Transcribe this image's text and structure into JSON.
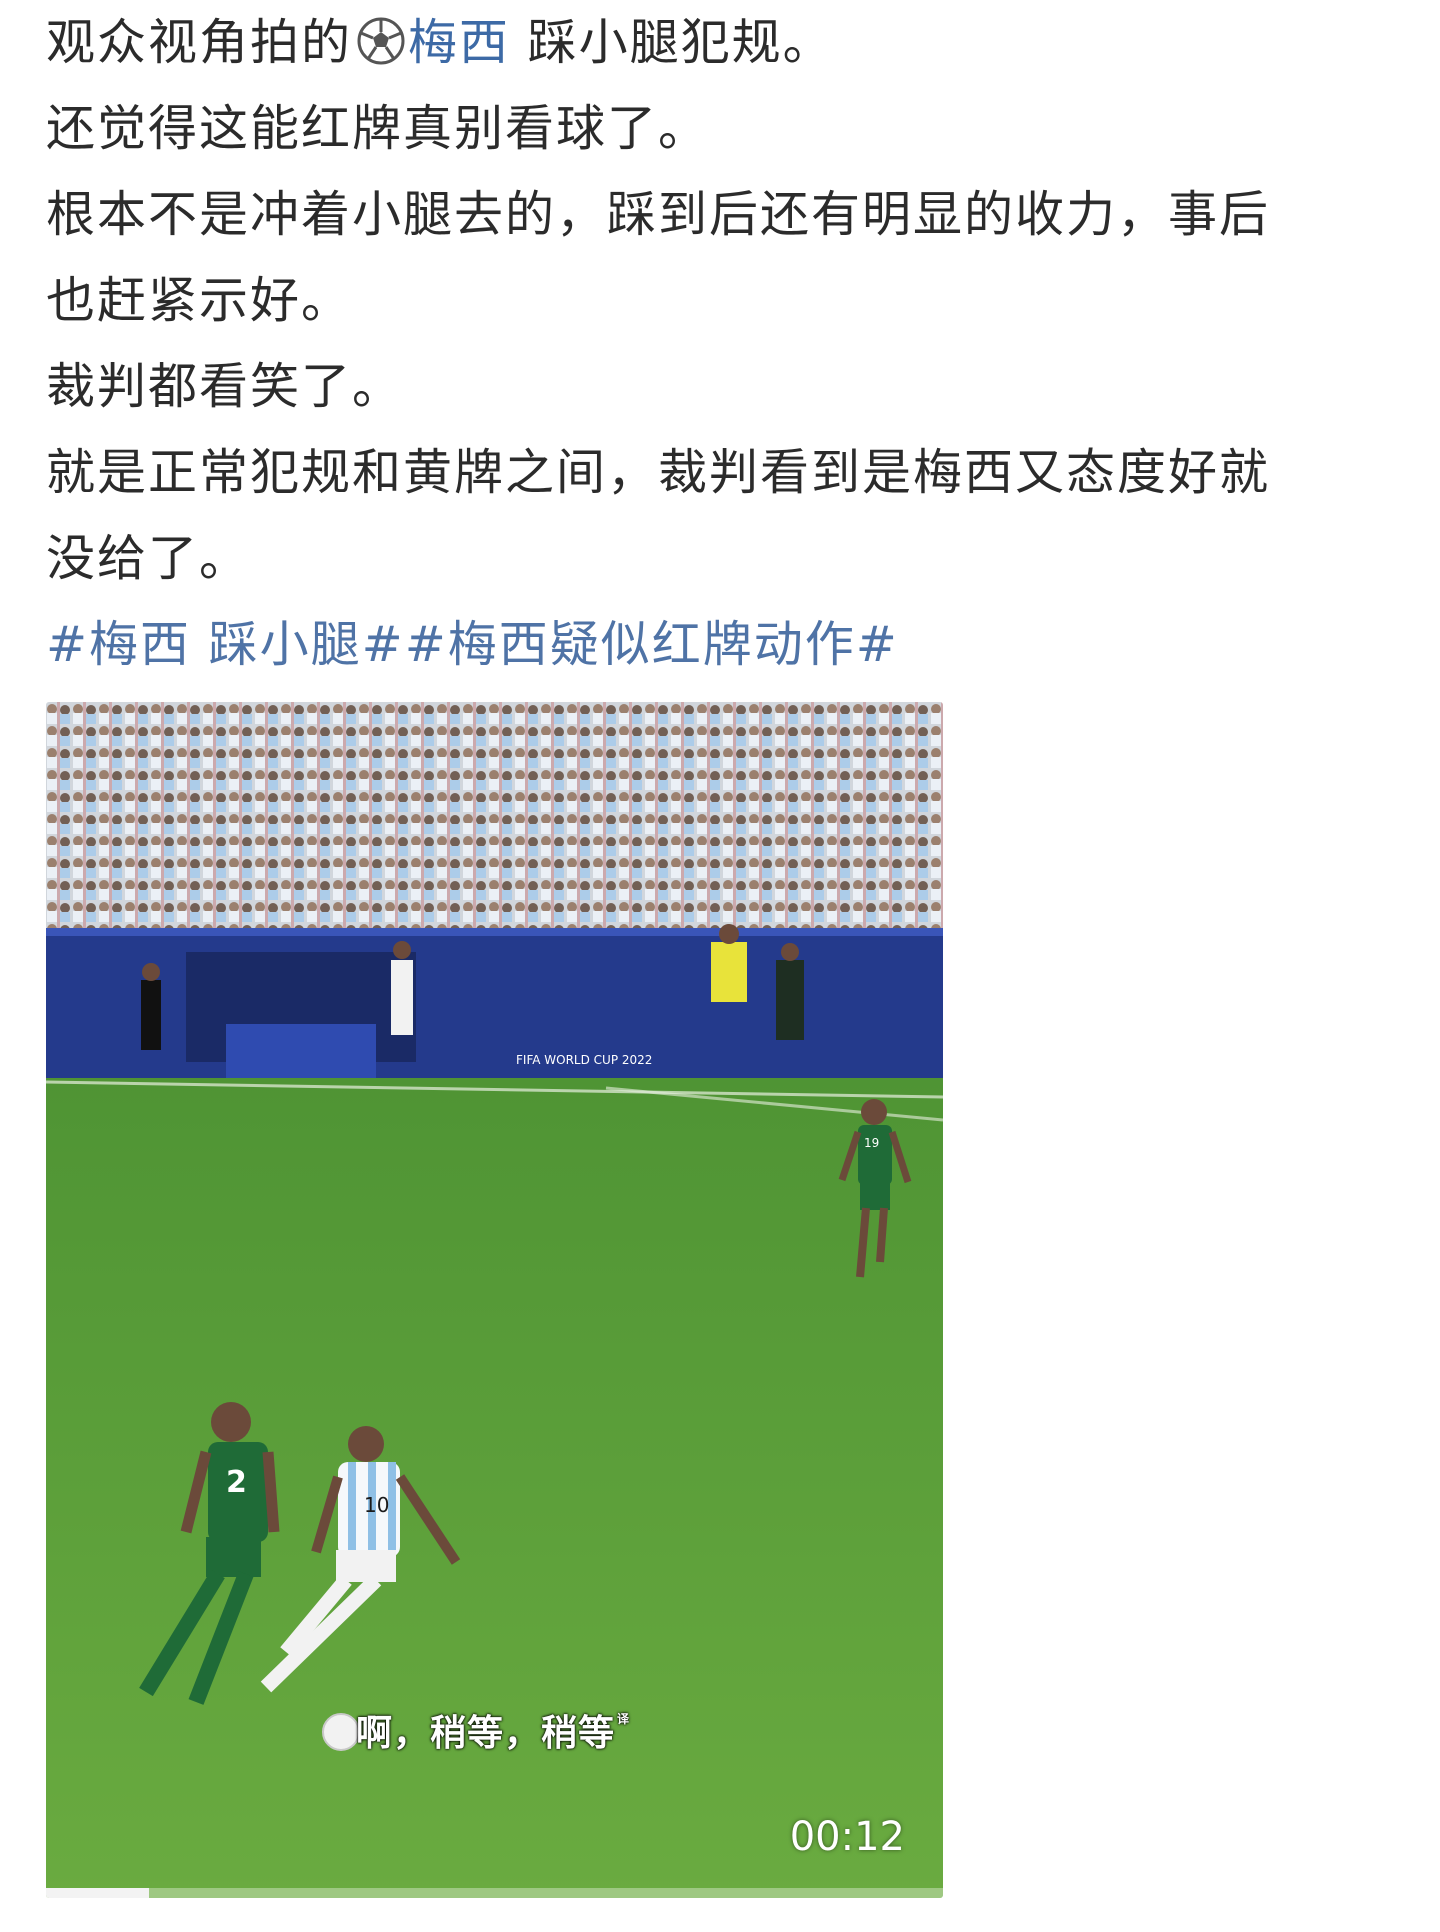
{
  "post": {
    "line1_before": "观众视角拍的",
    "mention": "梅西",
    "line1_after": " 踩小腿犯规。",
    "line2": "还觉得这能红牌真别看球了。",
    "line3a": "根本不是冲着小腿去的，踩到后还有明显的收力，事后",
    "line3b": "也赶紧示好。",
    "line4": "裁判都看笑了。",
    "line5a": "就是正常犯规和黄牌之间，裁判看到是梅西又态度好就",
    "line5b": "没给了。",
    "topic1": "#梅西 踩小腿#",
    "topic2": "#梅西疑似红牌动作#"
  },
  "video": {
    "subtitle": "啊，稍等，稍等",
    "subtitle_mark": "译",
    "timestamp": "00:12",
    "progress": 0.115,
    "board_text": "FIFA WORLD CUP 2022",
    "player_front_number": "2",
    "player_back_number": "10",
    "player_far_number": "19"
  },
  "colors": {
    "text": "#2b2b2b",
    "link": "#4f73a6",
    "pitch": "#5fa13c",
    "board": "#243a8c",
    "green_kit": "#1f6b37"
  }
}
